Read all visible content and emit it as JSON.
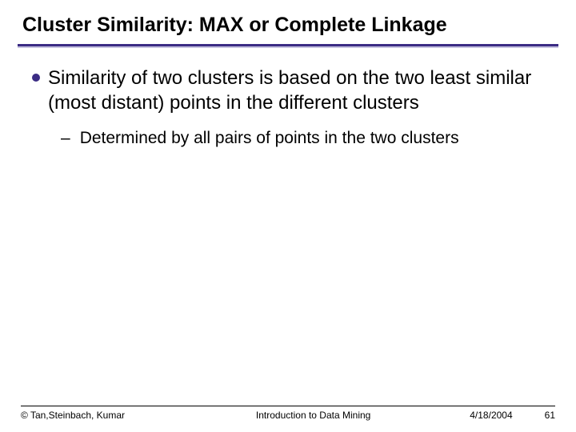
{
  "title": "Cluster Similarity: MAX or Complete Linkage",
  "bullet": {
    "text": "Similarity of two clusters is based on the two least similar (most distant) points in the different clusters"
  },
  "sub_bullet": {
    "dash": "–",
    "text": "Determined by all pairs of points in the two clusters"
  },
  "footer": {
    "copyright": "© Tan,Steinbach, Kumar",
    "center": "Introduction to Data Mining",
    "date": "4/18/2004",
    "page": "61"
  }
}
